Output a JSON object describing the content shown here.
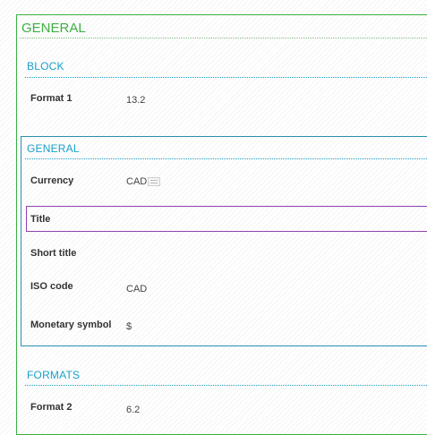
{
  "outer_section": {
    "title": "GENERAL"
  },
  "block_section": {
    "title": "BLOCK",
    "fields": [
      {
        "label": "Format 1",
        "value": "13.2"
      }
    ]
  },
  "general_section": {
    "title": "GENERAL",
    "fields": [
      {
        "label": "Currency",
        "value": "CAD",
        "icon": "list-picker-icon"
      },
      {
        "label": "Title",
        "value": ""
      },
      {
        "label": "Short title",
        "value": ""
      },
      {
        "label": "ISO code",
        "value": "CAD"
      },
      {
        "label": "Monetary symbol",
        "value": "$"
      }
    ]
  },
  "formats_section": {
    "title": "FORMATS",
    "fields": [
      {
        "label": "Format 2",
        "value": "6.2"
      }
    ]
  },
  "colors": {
    "outer_border": "#3cb043",
    "section_title": "#1a9fc9",
    "inner_border": "#2a8fb0",
    "title_row_border": "#8e44ad"
  }
}
